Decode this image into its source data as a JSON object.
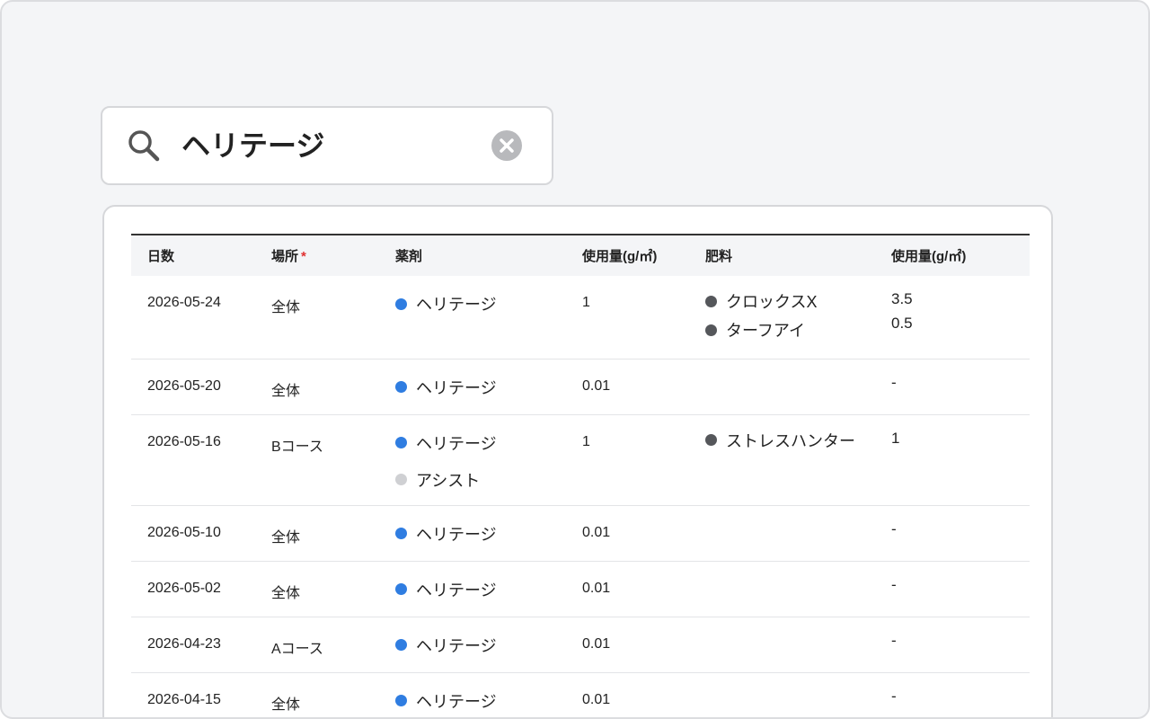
{
  "search": {
    "value": "ヘリテージ",
    "icon": "search-icon",
    "clear_icon": "clear-icon"
  },
  "table": {
    "headers": {
      "date": "日数",
      "place": "場所",
      "place_required": "*",
      "chemical": "薬剤",
      "chemical_amount": "使用量(g/㎡)",
      "fertilizer": "肥料",
      "fertilizer_amount": "使用量(g/㎡)"
    },
    "rows": [
      {
        "date": "2026-05-24",
        "place": "全体",
        "chemicals": [
          {
            "name": "ヘリテージ",
            "color": "#2f7de1"
          }
        ],
        "chemical_amount": "1",
        "fertilizers": [
          {
            "name": "クロックスX"
          },
          {
            "name": "ターフアイ"
          }
        ],
        "fertilizer_amounts": [
          "3.5",
          "0.5"
        ]
      },
      {
        "date": "2026-05-20",
        "place": "全体",
        "chemicals": [
          {
            "name": "ヘリテージ",
            "color": "#2f7de1"
          }
        ],
        "chemical_amount": "0.01",
        "fertilizers": [],
        "fertilizer_amounts": [
          "-"
        ]
      },
      {
        "date": "2026-05-16",
        "place": "Bコース",
        "chemicals": [
          {
            "name": "ヘリテージ",
            "color": "#2f7de1"
          },
          {
            "name": "アシスト",
            "color": "#cfd0d3"
          }
        ],
        "chemical_amount": "1",
        "fertilizers": [
          {
            "name": "ストレスハンター"
          }
        ],
        "fertilizer_amounts": [
          "1"
        ]
      },
      {
        "date": "2026-05-10",
        "place": "全体",
        "chemicals": [
          {
            "name": "ヘリテージ",
            "color": "#2f7de1"
          }
        ],
        "chemical_amount": "0.01",
        "fertilizers": [],
        "fertilizer_amounts": [
          "-"
        ]
      },
      {
        "date": "2026-05-02",
        "place": "全体",
        "chemicals": [
          {
            "name": "ヘリテージ",
            "color": "#2f7de1"
          }
        ],
        "chemical_amount": "0.01",
        "fertilizers": [],
        "fertilizer_amounts": [
          "-"
        ]
      },
      {
        "date": "2026-04-23",
        "place": "Aコース",
        "chemicals": [
          {
            "name": "ヘリテージ",
            "color": "#2f7de1"
          }
        ],
        "chemical_amount": "0.01",
        "fertilizers": [],
        "fertilizer_amounts": [
          "-"
        ]
      },
      {
        "date": "2026-04-15",
        "place": "全体",
        "chemicals": [
          {
            "name": "ヘリテージ",
            "color": "#2f7de1"
          }
        ],
        "chemical_amount": "0.01",
        "fertilizers": [],
        "fertilizer_amounts": [
          "-"
        ]
      }
    ]
  }
}
